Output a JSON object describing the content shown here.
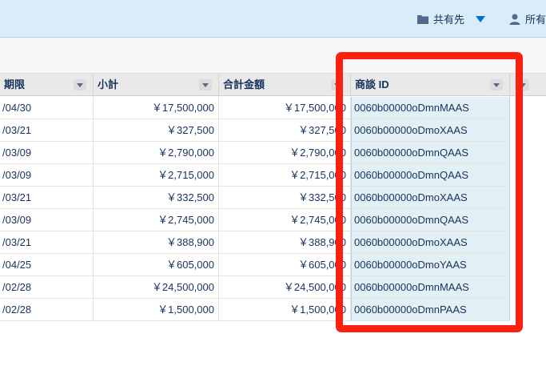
{
  "topbar": {
    "share_label": "共有先",
    "owner_label": "所有"
  },
  "columns": [
    {
      "label": "期限"
    },
    {
      "label": "小計"
    },
    {
      "label": "合計金額"
    },
    {
      "label": "商談 ID"
    }
  ],
  "rows": [
    {
      "date": "/04/30",
      "subtotal": "￥17,500,000",
      "total": "￥17,500,000",
      "id": "0060b00000oDmnMAAS"
    },
    {
      "date": "/03/21",
      "subtotal": "￥327,500",
      "total": "￥327,500",
      "id": "0060b00000oDmoXAAS"
    },
    {
      "date": "/03/09",
      "subtotal": "￥2,790,000",
      "total": "￥2,790,000",
      "id": "0060b00000oDmnQAAS"
    },
    {
      "date": "/03/09",
      "subtotal": "￥2,715,000",
      "total": "￥2,715,000",
      "id": "0060b00000oDmnQAAS"
    },
    {
      "date": "/03/21",
      "subtotal": "￥332,500",
      "total": "￥332,500",
      "id": "0060b00000oDmoXAAS"
    },
    {
      "date": "/03/09",
      "subtotal": "￥2,745,000",
      "total": "￥2,745,000",
      "id": "0060b00000oDmnQAAS"
    },
    {
      "date": "/03/21",
      "subtotal": "￥388,900",
      "total": "￥388,900",
      "id": "0060b00000oDmoXAAS"
    },
    {
      "date": "/04/25",
      "subtotal": "￥605,000",
      "total": "￥605,000",
      "id": "0060b00000oDmoYAAS"
    },
    {
      "date": "/02/28",
      "subtotal": "￥24,500,000",
      "total": "￥24,500,000",
      "id": "0060b00000oDmnMAAS"
    },
    {
      "date": "/02/28",
      "subtotal": "￥1,500,000",
      "total": "￥1,500,000",
      "id": "0060b00000oDmnPAAS"
    }
  ],
  "colors": {
    "highlight": "#ff1f0e",
    "header_bg": "#e9e9e9",
    "topbar_bg": "#d8edf7",
    "selected_column_bg": "#e2f0f6"
  }
}
